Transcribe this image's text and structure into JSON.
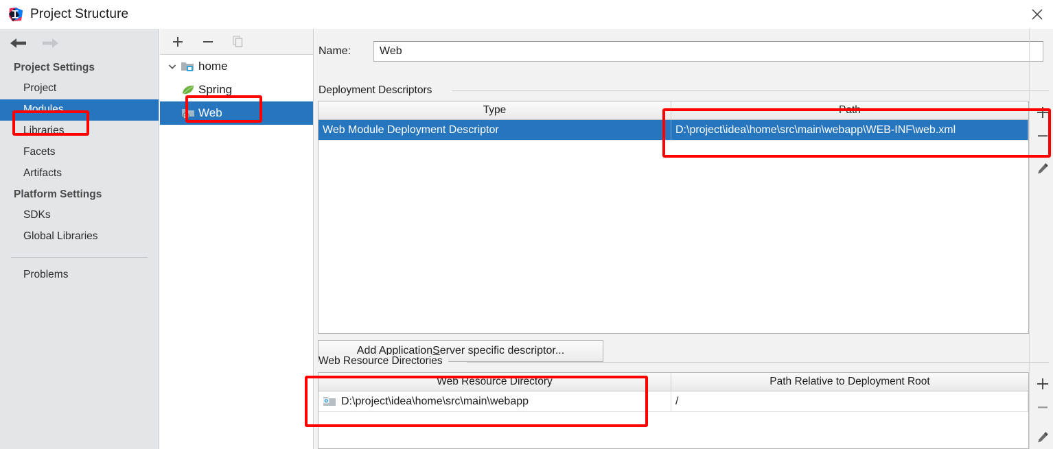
{
  "window": {
    "title": "Project Structure",
    "app_icon": "intellij-idea-logo",
    "close_icon": "close-icon"
  },
  "sidebar": {
    "nav": {
      "back_icon": "arrow-left-icon",
      "forward_icon": "arrow-right-icon"
    },
    "groups": [
      {
        "label": "Project Settings",
        "items": [
          {
            "label": "Project",
            "selected": false
          },
          {
            "label": "Modules",
            "selected": true
          },
          {
            "label": "Libraries",
            "selected": false
          },
          {
            "label": "Facets",
            "selected": false
          },
          {
            "label": "Artifacts",
            "selected": false
          }
        ]
      },
      {
        "label": "Platform Settings",
        "items": [
          {
            "label": "SDKs",
            "selected": false
          },
          {
            "label": "Global Libraries",
            "selected": false
          }
        ]
      }
    ],
    "footer_items": [
      {
        "label": "Problems",
        "selected": false
      }
    ]
  },
  "tree_panel": {
    "toolbar": [
      {
        "name": "add-module-button",
        "icon": "plus-icon",
        "enabled": true
      },
      {
        "name": "remove-module-button",
        "icon": "minus-icon",
        "enabled": true
      },
      {
        "name": "copy-module-button",
        "icon": "copy-icon",
        "enabled": false
      }
    ],
    "nodes": [
      {
        "label": "home",
        "icon": "module-folder-icon",
        "depth": 0,
        "expanded": true,
        "selected": false
      },
      {
        "label": "Spring",
        "icon": "spring-leaf-icon",
        "depth": 1,
        "selected": false
      },
      {
        "label": "Web",
        "icon": "web-facet-icon",
        "depth": 1,
        "selected": true
      }
    ]
  },
  "main": {
    "name_field": {
      "label": "Name:",
      "value": "Web",
      "placeholder": ""
    },
    "deployment_descriptors": {
      "group_label": "Deployment Descriptors",
      "columns": [
        "Type",
        "Path"
      ],
      "rows": [
        {
          "type": "Web Module Deployment Descriptor",
          "path": "D:\\project\\idea\\home\\src\\main\\webapp\\WEB-INF\\web.xml",
          "selected": true
        }
      ],
      "tools": [
        {
          "name": "add-descriptor-button",
          "icon": "plus-icon"
        },
        {
          "name": "remove-descriptor-button",
          "icon": "minus-icon"
        },
        {
          "name": "edit-descriptor-button",
          "icon": "pencil-icon"
        }
      ]
    },
    "add_descriptor_button": {
      "label_before": "Add Application ",
      "label_mnemonic": "S",
      "label_after": "erver specific descriptor..."
    },
    "web_resource_directories": {
      "group_label": "Web Resource Directories",
      "columns": [
        "Web Resource Directory",
        "Path Relative to Deployment Root"
      ],
      "rows": [
        {
          "icon": "web-resource-folder-icon",
          "directory": "D:\\project\\idea\\home\\src\\main\\webapp",
          "relative_path": "/",
          "selected": false
        }
      ],
      "tools": [
        {
          "name": "add-web-resource-button",
          "icon": "plus-icon"
        },
        {
          "name": "remove-web-resource-button",
          "icon": "minus-icon"
        },
        {
          "name": "edit-web-resource-button",
          "icon": "pencil-icon"
        }
      ]
    }
  },
  "annotations": {
    "highlight_color": "#ff0000",
    "boxes": [
      {
        "name": "highlight-modules-sidebar-item"
      },
      {
        "name": "highlight-web-tree-node"
      },
      {
        "name": "highlight-descriptor-path"
      },
      {
        "name": "highlight-web-resource-directory"
      }
    ]
  },
  "colors": {
    "selection_blue": "#2675bf",
    "sidebar_bg": "#e3e6e8",
    "content_bg": "#f2f2f2",
    "accent_red": "#ff0000"
  }
}
